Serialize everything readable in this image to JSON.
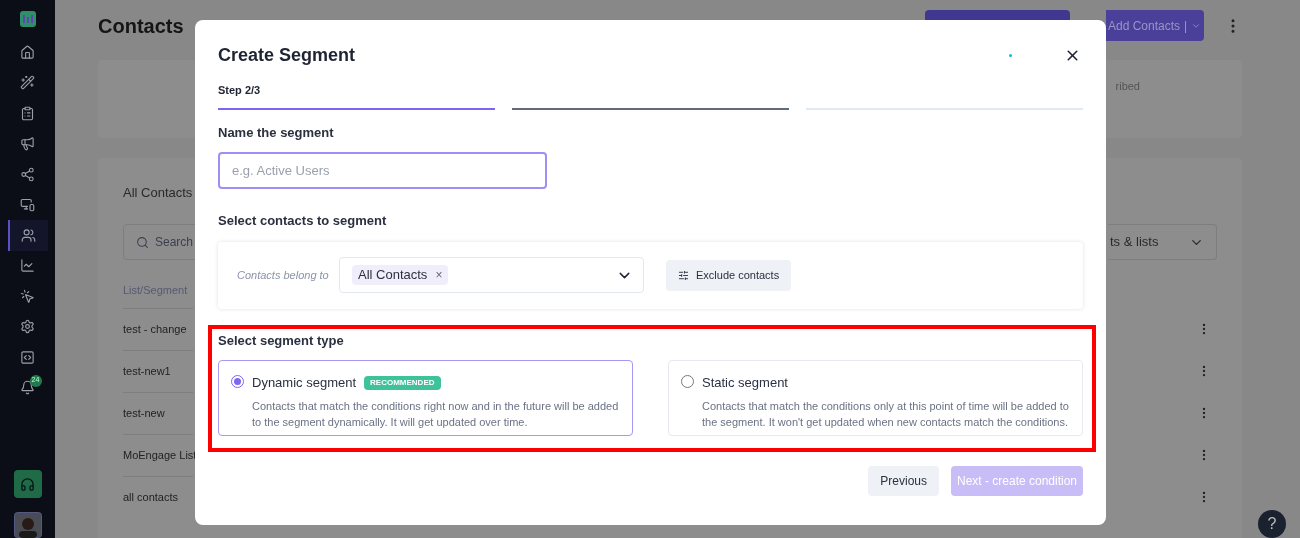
{
  "sidebar": {
    "items": [
      {
        "selected": false
      },
      {
        "selected": false
      },
      {
        "selected": false
      },
      {
        "selected": false
      },
      {
        "selected": false
      },
      {
        "selected": false
      },
      {
        "selected": true
      },
      {
        "selected": false
      },
      {
        "selected": false
      },
      {
        "selected": false
      },
      {
        "selected": false
      },
      {
        "selected": false,
        "badge": "24"
      }
    ]
  },
  "page": {
    "title": "Contacts",
    "add_button": "Add Contacts",
    "add_separator": "|",
    "stats_text": "ribed",
    "list_title": "All Contacts",
    "search": {
      "placeholder": "Search"
    },
    "filter_text": "ts & lists",
    "table": {
      "column": "List/Segment",
      "rows": [
        "test - change",
        "test-new1",
        "test-new",
        "MoEngage List",
        "all contacts"
      ]
    }
  },
  "help": "?",
  "modal": {
    "title": "Create Segment",
    "step_label": "Step 2/3",
    "steps": [
      {
        "kind": "done"
      },
      {
        "kind": "current"
      },
      {
        "kind": "pending"
      }
    ],
    "name_label": "Name the segment",
    "name_field": {
      "placeholder": "e.g. Active Users"
    },
    "contacts_label": "Select contacts to segment",
    "belong_label": "Contacts belong to",
    "chips": [
      "All Contacts"
    ],
    "chip_remove": "×",
    "exclude_button": "Exclude contacts",
    "type_label": "Select segment type",
    "types": [
      {
        "title": "Dynamic segment",
        "badge": "RECOMMENDED",
        "description": "Contacts that match the conditions right now and in the future will be added to the segment dynamically. It will get updated over time.",
        "selected": true
      },
      {
        "title": "Static segment",
        "description": "Contacts that match the conditions only at this point of time will be added to the segment. It won't get updated when new contacts match the conditions.",
        "selected": false
      }
    ],
    "previous_button": "Previous",
    "next_button": {
      "label": "Next - create condition",
      "disabled": true
    }
  }
}
